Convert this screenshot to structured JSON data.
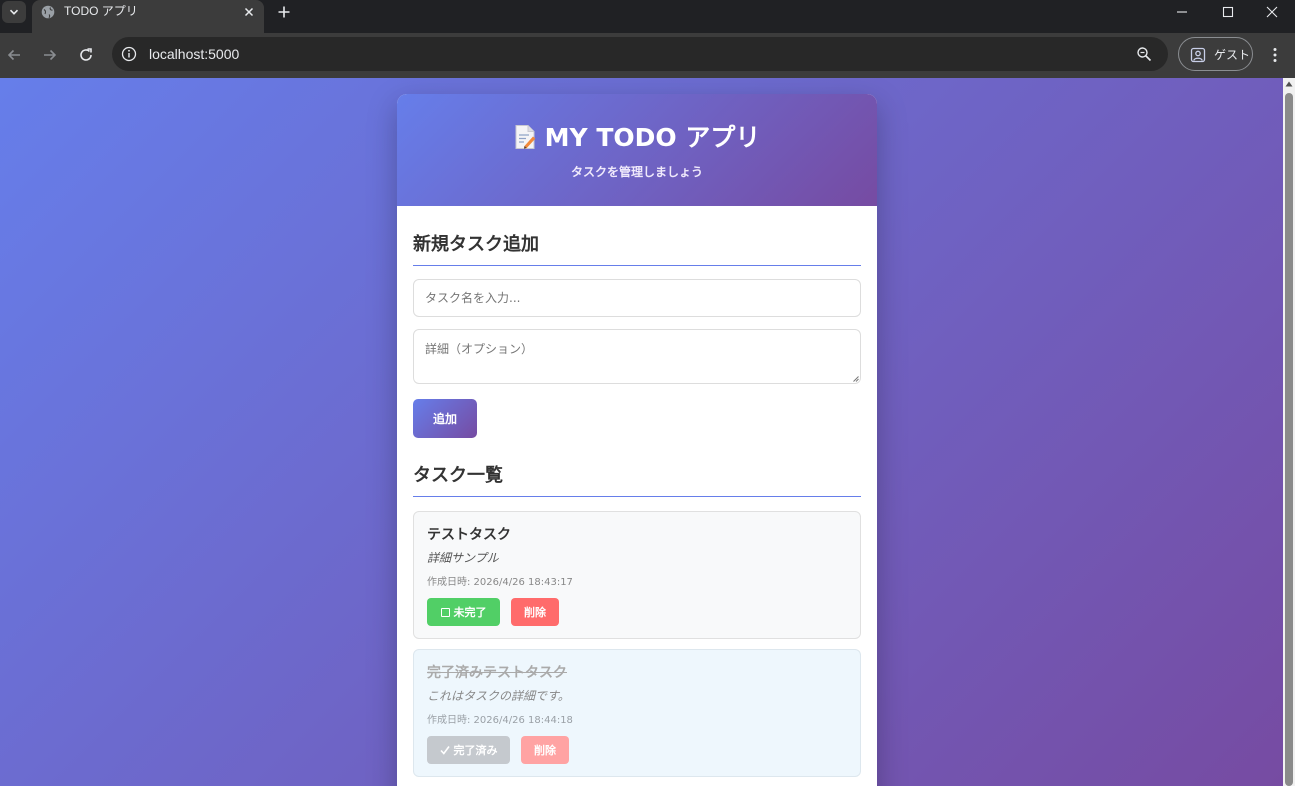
{
  "browser": {
    "tab_title": "TODO アプリ",
    "url": "localhost:5000",
    "guest_label": "ゲスト"
  },
  "app": {
    "title": "MY TODO アプリ",
    "subtitle": "タスクを管理しましょう",
    "title_icon": "memo-icon"
  },
  "new_task": {
    "heading": "新規タスク追加",
    "name_placeholder": "タスク名を入力...",
    "name_value": "",
    "detail_placeholder": "詳細（オプション）",
    "detail_value": "",
    "add_label": "追加"
  },
  "task_list": {
    "heading": "タスク一覧",
    "tasks": [
      {
        "title": "テストタスク",
        "detail": "詳細サンプル",
        "created": "作成日時: 2026/4/26 18:43:17",
        "status_label": "未完了",
        "status_icon": "checkbox-icon",
        "delete_label": "削除",
        "completed": false
      },
      {
        "title": "完了済みテストタスク",
        "detail": "これはタスクの詳細です。",
        "created": "作成日時: 2026/4/26 18:44:18",
        "status_label": "完了済み",
        "status_icon": "checkmark-icon",
        "delete_label": "削除",
        "completed": true
      }
    ]
  },
  "colors": {
    "gradient_start": "#667eea",
    "gradient_end": "#764ba2",
    "incomplete_button": "#51cf66",
    "delete_button": "#ff6b6b"
  }
}
